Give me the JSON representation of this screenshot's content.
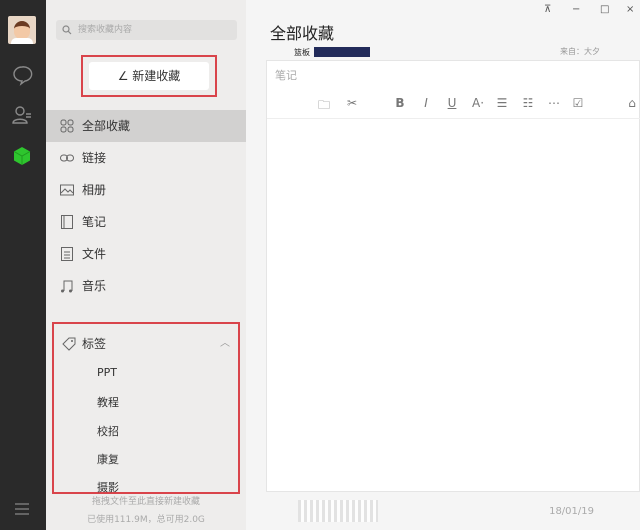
{
  "window": {
    "controls": [
      "pin",
      "minimize",
      "maximize",
      "close"
    ]
  },
  "search": {
    "placeholder": "搜索收藏内容"
  },
  "new_button": "新建收藏",
  "nav": [
    {
      "label": "全部收藏",
      "icon": "grid-icon",
      "active": true
    },
    {
      "label": "链接",
      "icon": "link-icon"
    },
    {
      "label": "相册",
      "icon": "image-icon"
    },
    {
      "label": "笔记",
      "icon": "notebook-icon"
    },
    {
      "label": "文件",
      "icon": "file-icon"
    },
    {
      "label": "音乐",
      "icon": "music-icon"
    }
  ],
  "tags": {
    "label": "标签",
    "items": [
      "PPT",
      "教程",
      "校招",
      "康复",
      "摄影"
    ]
  },
  "footer": {
    "hint": "拖拽文件至此直接新建收藏",
    "usage": "已使用111.9M，总可用2.0G"
  },
  "main": {
    "title": "全部收藏",
    "peek_item": {
      "label": "篮板",
      "from": "来自：大夕"
    },
    "editor": {
      "placeholder": "笔记"
    },
    "bottom_item": {
      "date": "18/01/19"
    }
  }
}
